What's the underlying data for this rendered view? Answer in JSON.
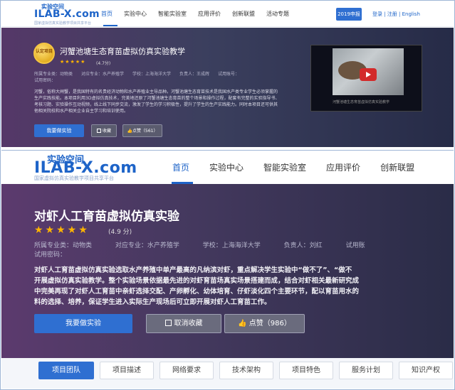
{
  "panel1": {
    "logo_top": "实验空间",
    "logo_main": "ILAB-X.com",
    "logo_sub": "国家虚拟仿真实验教学项目共享平台",
    "menu": [
      "首页",
      "实验中心",
      "智能实验室",
      "应用评价",
      "创新联盟",
      "活动专题"
    ],
    "badge": "2019申报",
    "user": "登录 | 注册 | English",
    "medal_text": "认定项目",
    "title": "河蟹池塘生态育苗虚拟仿真实验教学",
    "score": "(4.7分)",
    "meta_line1": "所属专业类：动物类　　对应专业：水产养殖学　　学校：上海海洋大学　　负责人：王成辉　　试用账号：",
    "meta_line2": "试用密码：",
    "description": "河蟹，俗称大闸蟹，是我国特有的名贵经济动物和水产养殖业主导品种。河蟹池塘生态育苗技术是我国水产类专业学生必须掌握的生产实践技能。本项目利用3D虚拟仿真技术，完美地还原了河蟹池塘生态育苗的整个场景和操作过程，配套有完整的实验指导书、考核习题、实验操作互动视频，线上线下同步交流，激发了学生的学习积极性，提升了学生的生产实践能力。同时本项目还可供其他相关院校和水产相关企业自主学习和培训使用。",
    "btn_do": "我要做实验",
    "btn_collect": "收藏",
    "btn_like": "点赞（561）",
    "video_caption": "河蟹池塘生态育苗虚拟仿真实验教学"
  },
  "panel2": {
    "logo_top": "实验空间",
    "logo_main": "ILAB-X.com",
    "logo_sub": "国家虚拟仿真实验教学项目共享平台",
    "menu": [
      "首页",
      "实验中心",
      "智能实验室",
      "应用评价",
      "创新联盟"
    ],
    "title": "对虾人工育苗虚拟仿真实验",
    "score": "(4.9 分)",
    "meta": [
      "所属专业类：动物类",
      "对应专业：水产养殖学",
      "学校：上海海洋大学",
      "负责人：刘红",
      "试用账"
    ],
    "pwd": "试用密码：",
    "desc_lines": [
      "对虾人工育苗虚拟仿真实验选取水产养殖中单产最高的凡纳滨对虾，重点解决学生实验中“做不了”、“做不",
      "开展虚拟仿真实验教学。整个实验场景依据最先进的对虾育苗场真实场景搭建而成，结合对虾相关最新研究成",
      "中完美再现了对虾人工育苗中亲虾选择交配、产卵孵化、幼体培育、仔虾淡化四个主要环节，配以育苗用水的",
      "料的选择、培养，保证学生进入实际生产现场后可立即开展对虾人工育苗工作。"
    ],
    "btn_do": "我要做实验",
    "btn_collect": "取消收藏",
    "btn_like": "点赞（986）",
    "tabs": [
      "项目团队",
      "项目描述",
      "网络要求",
      "技术架构",
      "项目特色",
      "服务计划",
      "知识产权"
    ]
  },
  "colors": {
    "brand_blue": "#1e64c8",
    "button_blue": "#2f6fd1",
    "star": "#ffb400"
  }
}
